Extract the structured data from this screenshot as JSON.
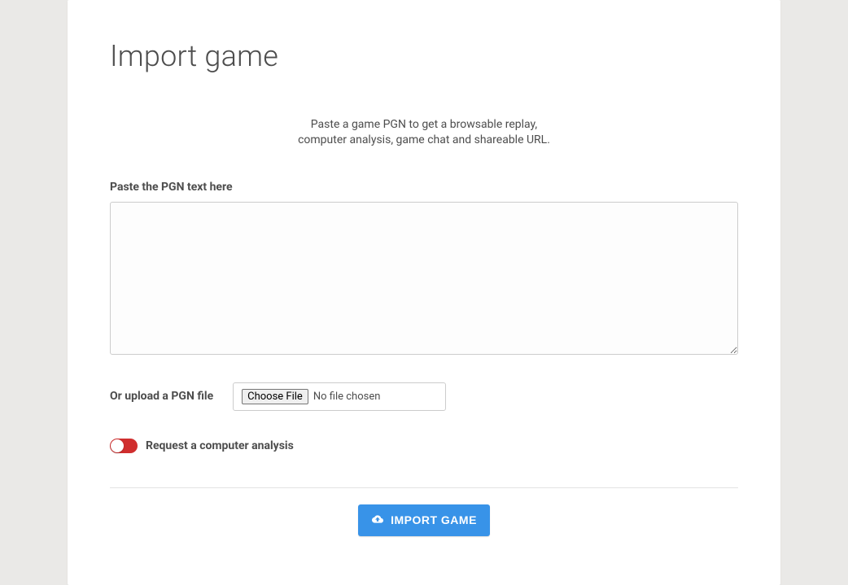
{
  "title": "Import game",
  "description_line1": "Paste a game PGN to get a browsable replay,",
  "description_line2": "computer analysis, game chat and shareable URL.",
  "pgn_label": "Paste the PGN text here",
  "pgn_value": "",
  "upload_label": "Or upload a PGN file",
  "choose_file_label": "Choose File",
  "file_status": "No file chosen",
  "analysis_label": "Request a computer analysis",
  "submit_label": "Import Game"
}
